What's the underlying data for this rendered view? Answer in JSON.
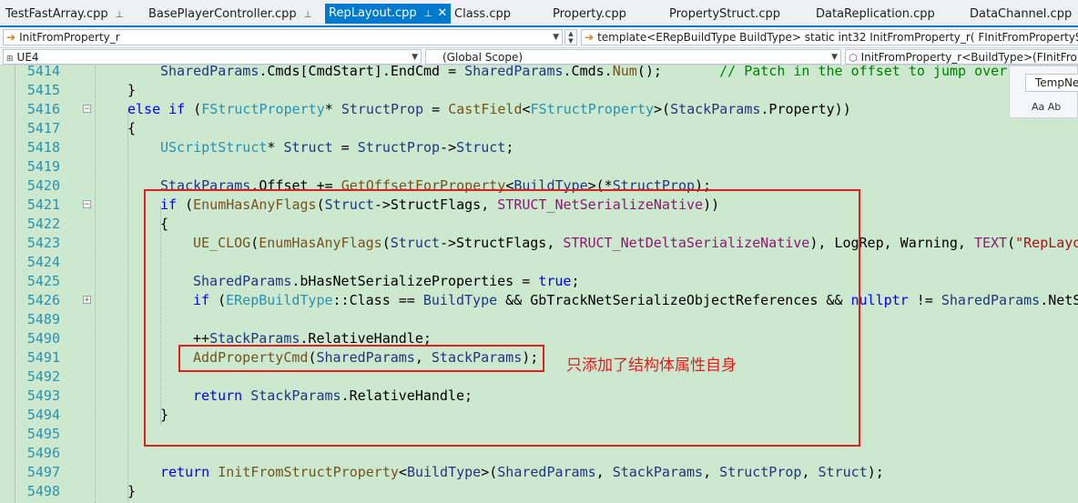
{
  "tabs": [
    {
      "label": "TestFastArray.cpp",
      "pin": "⊥"
    },
    {
      "label": "BasePlayerController.cpp",
      "pin": "⊥"
    },
    {
      "label": "RepLayout.cpp",
      "pin": "⊥",
      "close": "✕"
    },
    {
      "label": "Class.cpp"
    },
    {
      "label": "Property.cpp"
    },
    {
      "label": "PropertyStruct.cpp"
    },
    {
      "label": "DataReplication.cpp"
    },
    {
      "label": "DataChannel.cpp"
    }
  ],
  "nav": {
    "function_combo": "InitFromProperty_r",
    "signature_combo": "template<ERepBuildType BuildType> static int32 InitFromProperty_r( FInitFromPropertySh",
    "project_combo": "UE4",
    "scope_combo": "(Global Scope)",
    "member_combo": "InitFromProperty_r<BuildType>(FInitFron"
  },
  "find_popup": {
    "value": "TempNe",
    "options": "Aa  Ab"
  },
  "code_lines": [
    {
      "n": "5414",
      "indent": 1,
      "html_text": "SharedParams.Cmds[CmdStart].EndCmd = SharedParams.Cmds.Num();       // Patch in the offset to jump over"
    },
    {
      "n": "5415",
      "indent": 0,
      "html_text": "}"
    },
    {
      "n": "5416",
      "indent": 0,
      "html_text": "else if (FStructProperty* StructProp = CastField<FStructProperty>(StackParams.Property))",
      "fold": "minus"
    },
    {
      "n": "5417",
      "indent": 0,
      "html_text": "{"
    },
    {
      "n": "5418",
      "indent": 1,
      "html_text": "UScriptStruct* Struct = StructProp->Struct;"
    },
    {
      "n": "5419",
      "indent": 1,
      "html_text": ""
    },
    {
      "n": "5420",
      "indent": 1,
      "html_text": "StackParams.Offset += GetOffsetForProperty<BuildType>(*StructProp);"
    },
    {
      "n": "5421",
      "indent": 1,
      "html_text": "if (EnumHasAnyFlags(Struct->StructFlags, STRUCT_NetSerializeNative))",
      "fold": "minus"
    },
    {
      "n": "5422",
      "indent": 1,
      "html_text": "{"
    },
    {
      "n": "5423",
      "indent": 2,
      "html_text": "UE_CLOG(EnumHasAnyFlags(Struct->StructFlags, STRUCT_NetDeltaSerializeNative), LogRep, Warning, TEXT(\"RepLayo"
    },
    {
      "n": "5424",
      "indent": 2,
      "html_text": ""
    },
    {
      "n": "5425",
      "indent": 2,
      "html_text": "SharedParams.bHasNetSerializeProperties = true;"
    },
    {
      "n": "5426",
      "indent": 2,
      "html_text": "if (ERepBuildType::Class == BuildType && GbTrackNetSerializeObjectReferences && nullptr != SharedParams.NetS",
      "fold": "plus"
    },
    {
      "n": "5489",
      "indent": 2,
      "html_text": ""
    },
    {
      "n": "5490",
      "indent": 2,
      "html_text": "++StackParams.RelativeHandle;"
    },
    {
      "n": "5491",
      "indent": 2,
      "html_text": "AddPropertyCmd(SharedParams, StackParams);"
    },
    {
      "n": "5492",
      "indent": 2,
      "html_text": ""
    },
    {
      "n": "5493",
      "indent": 2,
      "html_text": "return StackParams.RelativeHandle;"
    },
    {
      "n": "5494",
      "indent": 1,
      "html_text": "}"
    },
    {
      "n": "5495",
      "indent": 1,
      "html_text": ""
    },
    {
      "n": "5496",
      "indent": 1,
      "html_text": ""
    },
    {
      "n": "5497",
      "indent": 1,
      "html_text": "return InitFromStructProperty<BuildType>(SharedParams, StackParams, StructProp, Struct);"
    },
    {
      "n": "5498",
      "indent": 0,
      "html_text": "}"
    }
  ],
  "annotation": "只添加了结构体属性自身",
  "colors": {
    "editor_bg": "#cce8cf",
    "keyword": "#0000ff",
    "type": "#2b91af",
    "function": "#74531f",
    "highlight_box": "#e02020",
    "tab_active": "#007acc"
  }
}
